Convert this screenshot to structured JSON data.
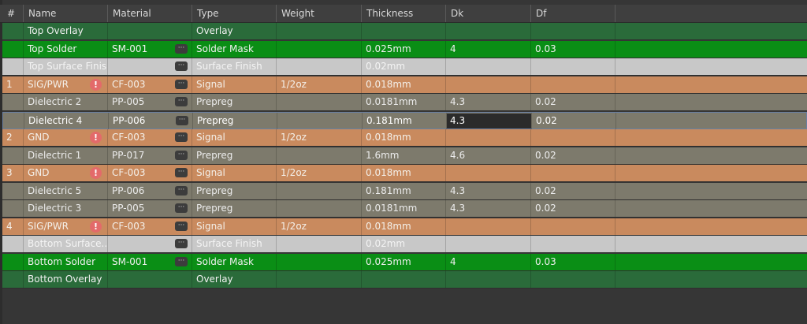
{
  "columns": [
    "#",
    "Name",
    "Material",
    "Type",
    "Weight",
    "Thickness",
    "Dk",
    "Df"
  ],
  "buttons": {
    "more_label": "···",
    "warn_label": "!"
  },
  "colors": {
    "overlay": "#2a6b3a",
    "solder_mask": "#0a8e15",
    "surface_finish": "#c8c8c8",
    "copper": "#c98a5e",
    "dielectric": "#7d7a6c"
  },
  "rows": [
    {
      "kind": "ov",
      "num": "",
      "name": "Top Overlay",
      "material": "",
      "type": "Overlay",
      "weight": "",
      "thickness": "",
      "dk": "",
      "df": "",
      "btn": false,
      "warn": false
    },
    {
      "kind": "sm",
      "num": "",
      "name": "Top Solder",
      "material": "SM-001",
      "type": "Solder Mask",
      "weight": "",
      "thickness": "0.025mm",
      "dk": "4",
      "df": "0.03",
      "btn": true,
      "warn": false
    },
    {
      "kind": "sf",
      "num": "",
      "name": "Top Surface Finish",
      "material": "",
      "type": "Surface Finish",
      "weight": "",
      "thickness": "0.02mm",
      "dk": "",
      "df": "",
      "btn": true,
      "warn": false
    },
    {
      "kind": "cu",
      "num": "1",
      "name": "SIG/PWR",
      "material": "CF-003",
      "type": "Signal",
      "weight": "1/2oz",
      "thickness": "0.018mm",
      "dk": "",
      "df": "",
      "btn": true,
      "warn": true
    },
    {
      "kind": "pp",
      "num": "",
      "name": "Dielectric 2",
      "material": "PP-005",
      "type": "Prepreg",
      "weight": "",
      "thickness": "0.0181mm",
      "dk": "4.3",
      "df": "0.02",
      "btn": true,
      "warn": false
    },
    {
      "kind": "sel",
      "num": "",
      "name": "Dielectric 4",
      "material": "PP-006",
      "type": "Prepreg",
      "weight": "",
      "thickness": "0.181mm",
      "dk": "4.3",
      "df": "0.02",
      "btn": true,
      "warn": false
    },
    {
      "kind": "cu",
      "num": "2",
      "name": "GND",
      "material": "CF-003",
      "type": "Signal",
      "weight": "1/2oz",
      "thickness": "0.018mm",
      "dk": "",
      "df": "",
      "btn": true,
      "warn": true
    },
    {
      "kind": "pp",
      "num": "",
      "name": "Dielectric 1",
      "material": "PP-017",
      "type": "Prepreg",
      "weight": "",
      "thickness": "1.6mm",
      "dk": "4.6",
      "df": "0.02",
      "btn": true,
      "warn": false
    },
    {
      "kind": "cu",
      "num": "3",
      "name": "GND",
      "material": "CF-003",
      "type": "Signal",
      "weight": "1/2oz",
      "thickness": "0.018mm",
      "dk": "",
      "df": "",
      "btn": true,
      "warn": true
    },
    {
      "kind": "pp",
      "num": "",
      "name": "Dielectric 5",
      "material": "PP-006",
      "type": "Prepreg",
      "weight": "",
      "thickness": "0.181mm",
      "dk": "4.3",
      "df": "0.02",
      "btn": true,
      "warn": false
    },
    {
      "kind": "pp",
      "num": "",
      "name": "Dielectric 3",
      "material": "PP-005",
      "type": "Prepreg",
      "weight": "",
      "thickness": "0.0181mm",
      "dk": "4.3",
      "df": "0.02",
      "btn": true,
      "warn": false
    },
    {
      "kind": "cu",
      "num": "4",
      "name": "SIG/PWR",
      "material": "CF-003",
      "type": "Signal",
      "weight": "1/2oz",
      "thickness": "0.018mm",
      "dk": "",
      "df": "",
      "btn": true,
      "warn": true
    },
    {
      "kind": "sf",
      "num": "",
      "name": "Bottom Surface...",
      "material": "",
      "type": "Surface Finish",
      "weight": "",
      "thickness": "0.02mm",
      "dk": "",
      "df": "",
      "btn": true,
      "warn": false
    },
    {
      "kind": "sm",
      "num": "",
      "name": "Bottom Solder",
      "material": "SM-001",
      "type": "Solder Mask",
      "weight": "",
      "thickness": "0.025mm",
      "dk": "4",
      "df": "0.03",
      "btn": true,
      "warn": false
    },
    {
      "kind": "ov",
      "num": "",
      "name": "Bottom Overlay",
      "material": "",
      "type": "Overlay",
      "weight": "",
      "thickness": "",
      "dk": "",
      "df": "",
      "btn": false,
      "warn": false
    }
  ]
}
